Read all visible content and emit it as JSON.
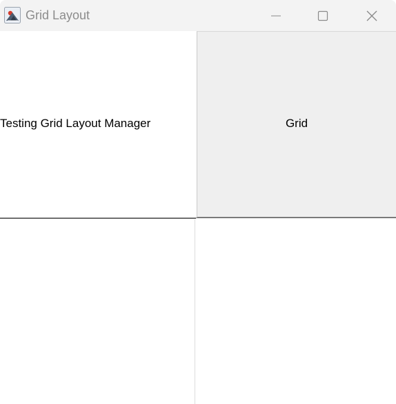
{
  "window": {
    "title": "Grid Layout",
    "icon": "java-app-icon",
    "controls": {
      "minimize": "minimize-icon",
      "maximize": "maximize-icon",
      "close": "close-icon"
    }
  },
  "grid": {
    "label_text": "Testing Grid Layout Manager",
    "button_label": "Grid"
  },
  "colors": {
    "titlebar_bg": "#f3f3f3",
    "title_text": "#8c8c8c",
    "button_bg": "#efefef",
    "content_bg": "#ffffff"
  }
}
